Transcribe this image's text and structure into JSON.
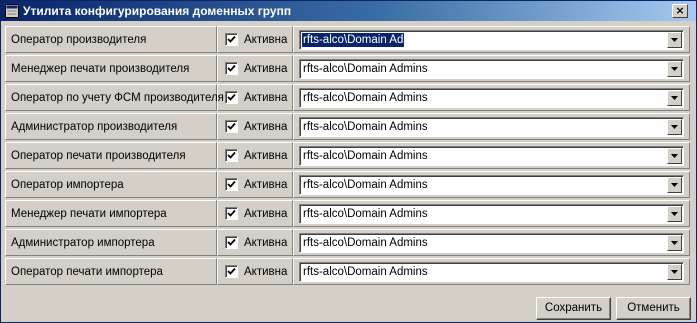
{
  "window": {
    "title": "Утилита конфигурирования доменных групп",
    "close_label": "×"
  },
  "rows": [
    {
      "label": "Оператор производителя",
      "checked": true,
      "check_label": "Активна",
      "value": "rfts-alco\\Domain Ad",
      "selected": true
    },
    {
      "label": "Менеджер печати производителя",
      "checked": true,
      "check_label": "Активна",
      "value": "rfts-alco\\Domain Admins",
      "selected": false
    },
    {
      "label": "Оператор по учету ФСМ производителя",
      "checked": true,
      "check_label": "Активна",
      "value": "rfts-alco\\Domain Admins",
      "selected": false
    },
    {
      "label": "Администратор производителя",
      "checked": true,
      "check_label": "Активна",
      "value": "rfts-alco\\Domain Admins",
      "selected": false
    },
    {
      "label": "Оператор печати производителя",
      "checked": true,
      "check_label": "Активна",
      "value": "rfts-alco\\Domain Admins",
      "selected": false
    },
    {
      "label": "Оператор импортера",
      "checked": true,
      "check_label": "Активна",
      "value": "rfts-alco\\Domain Admins",
      "selected": false
    },
    {
      "label": "Менеджер печати импортера",
      "checked": true,
      "check_label": "Активна",
      "value": "rfts-alco\\Domain Admins",
      "selected": false
    },
    {
      "label": "Администратор импортера",
      "checked": true,
      "check_label": "Активна",
      "value": "rfts-alco\\Domain Admins",
      "selected": false
    },
    {
      "label": "Оператор печати импортера",
      "checked": true,
      "check_label": "Активна",
      "value": "rfts-alco\\Domain Admins",
      "selected": false
    }
  ],
  "buttons": {
    "save_label": "Сохранить",
    "cancel_label": "Отменить"
  },
  "icons": {
    "app": "app-window-icon",
    "checkbox": "checkmark-icon",
    "dropdown": "dropdown-arrow-icon"
  },
  "colors": {
    "titlebar_start": "#0a246a",
    "titlebar_end": "#a6caf0",
    "selection": "#0a246a",
    "face": "#d4d0c8"
  }
}
